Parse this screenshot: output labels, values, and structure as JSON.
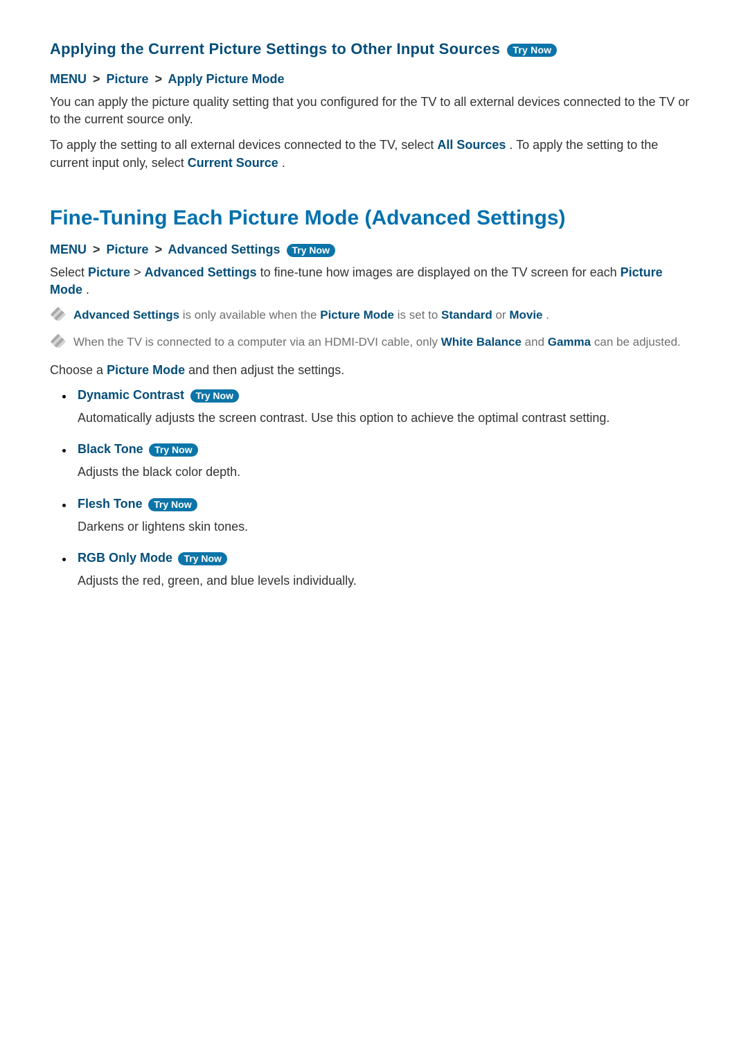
{
  "try_now": "Try Now",
  "bc_sep": ">",
  "sec1": {
    "title": "Applying the Current Picture Settings to Other Input Sources",
    "crumb": [
      "MENU",
      "Picture",
      "Apply Picture Mode"
    ],
    "p1": "You can apply the picture quality setting that you configured for the TV to all external devices connected to the TV or to the current source only.",
    "p2_a": "To apply the setting to all external devices connected to the TV, select ",
    "p2_term1": "All Sources",
    "p2_b": ". To apply the setting to the current input only, select ",
    "p2_term2": "Current Source",
    "p2_c": "."
  },
  "sec2": {
    "title": "Fine-Tuning Each Picture Mode (Advanced Settings)",
    "crumb": [
      "MENU",
      "Picture",
      "Advanced Settings"
    ],
    "intro_a": "Select ",
    "intro_t1": "Picture",
    "intro_mid": " > ",
    "intro_t2": "Advanced Settings",
    "intro_b": " to fine-tune how images are displayed on the TV screen for each ",
    "intro_t3": "Picture Mode",
    "intro_c": ".",
    "note1_a": "Advanced Settings",
    "note1_b": " is only available when the ",
    "note1_c": "Picture Mode",
    "note1_d": " is set to ",
    "note1_e": "Standard",
    "note1_f": " or ",
    "note1_g": "Movie",
    "note1_h": ".",
    "note2_a": "When the TV is connected to a computer via an HDMI-DVI cable, only ",
    "note2_b": "White Balance",
    "note2_c": " and ",
    "note2_d": "Gamma",
    "note2_e": " can be adjusted.",
    "choose_a": "Choose a ",
    "choose_t": "Picture Mode",
    "choose_b": " and then adjust the settings.",
    "items": [
      {
        "title": "Dynamic Contrast",
        "desc": "Automatically adjusts the screen contrast. Use this option to achieve the optimal contrast setting."
      },
      {
        "title": "Black Tone",
        "desc": "Adjusts the black color depth."
      },
      {
        "title": "Flesh Tone",
        "desc": "Darkens or lightens skin tones."
      },
      {
        "title": "RGB Only Mode",
        "desc": "Adjusts the red, green, and blue levels individually."
      }
    ]
  }
}
